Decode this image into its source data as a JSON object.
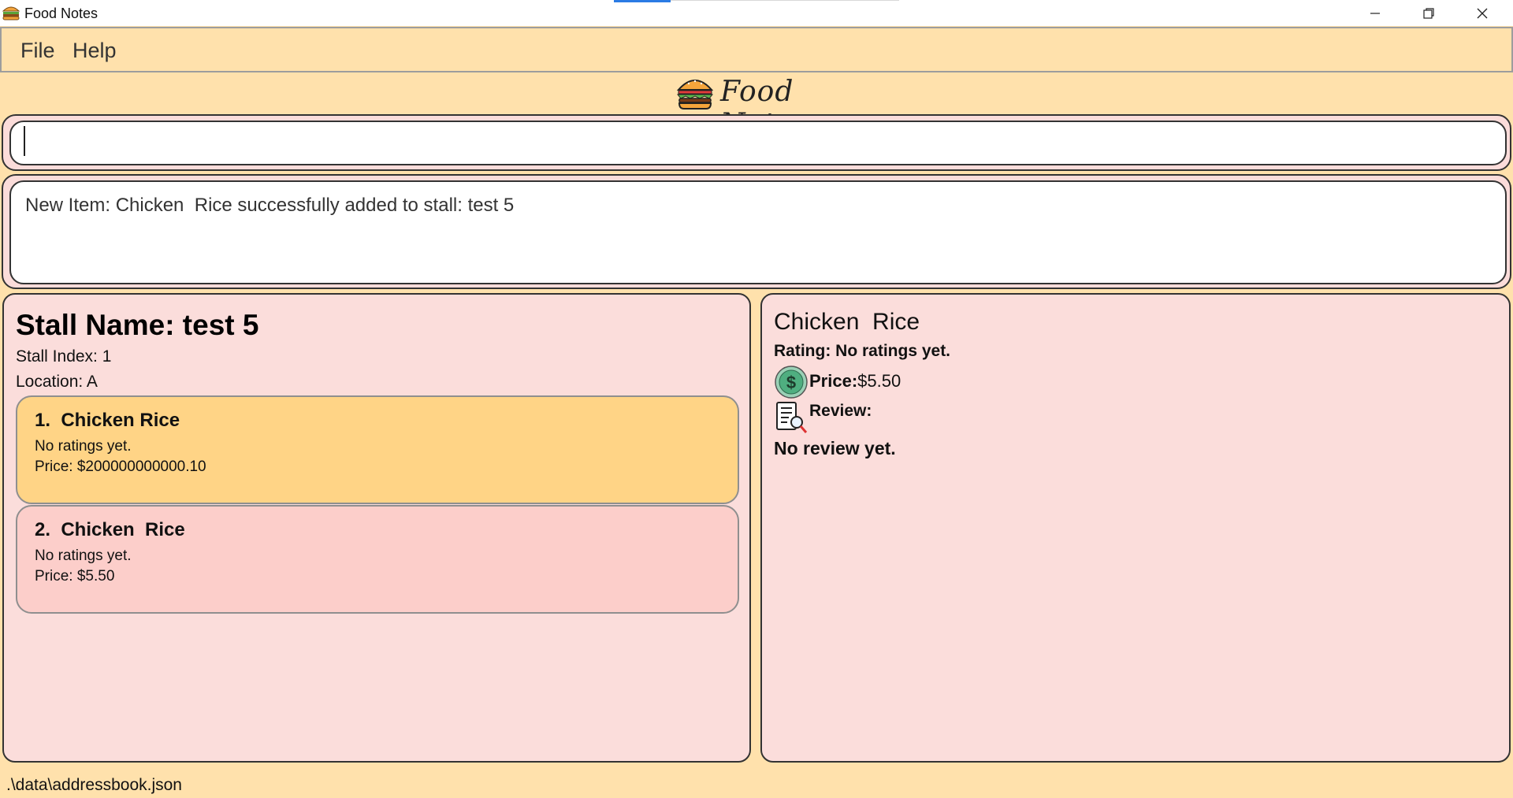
{
  "window": {
    "title": "Food Notes",
    "app_icon": "burger-icon",
    "controls": [
      "minimize-icon",
      "restore-icon",
      "close-icon"
    ]
  },
  "menu": {
    "items": [
      {
        "label": "File"
      },
      {
        "label": "Help"
      }
    ]
  },
  "logo": {
    "text": "Food Notes",
    "icon": "burger-icon"
  },
  "command": {
    "value": "",
    "placeholder": ""
  },
  "result": {
    "message": "New Item: Chicken  Rice successfully added to stall: test 5"
  },
  "stall": {
    "name_line": "Stall Name: test 5",
    "index_line": "Stall Index: 1",
    "location_line": "Location: A",
    "items": [
      {
        "title": "1.  Chicken Rice",
        "rating": "No ratings yet.",
        "price": "Price: $200000000000.10",
        "selected": true
      },
      {
        "title": "2.  Chicken  Rice",
        "rating": "No ratings yet.",
        "price": "Price: $5.50",
        "selected": false
      }
    ]
  },
  "detail": {
    "name": "Chicken  Rice",
    "rating": "Rating: No ratings yet.",
    "price_label": "Price:",
    "price_value": "$5.50",
    "review_label": "Review:",
    "review_text": "No review yet.",
    "price_icon": "dollar-icon",
    "review_icon": "review-document-icon"
  },
  "status": {
    "file_path": ".\\data\\addressbook.json"
  },
  "colors": {
    "background": "#ffe1ac",
    "panel": "#fbdddb",
    "selected_card": "#ffd486",
    "normal_card": "#fcceca",
    "title_accent": "#2b7be4"
  }
}
